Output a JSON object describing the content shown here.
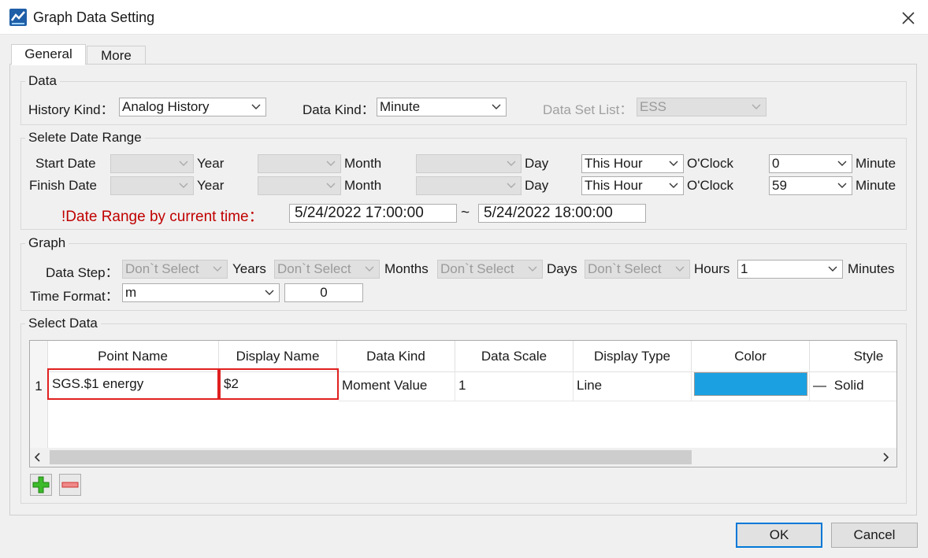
{
  "window": {
    "title": "Graph Data Setting",
    "close_glyph": "✕"
  },
  "tabs": [
    {
      "label": "General",
      "active": true
    },
    {
      "label": "More",
      "active": false
    }
  ],
  "data_group": {
    "legend": "Data",
    "history_kind": {
      "label": "History Kind：",
      "value": "Analog History"
    },
    "data_kind": {
      "label": "Data Kind：",
      "value": "Minute"
    },
    "data_set_list": {
      "label": "Data Set List：",
      "value": "ESS",
      "disabled": true
    }
  },
  "date_range": {
    "legend": "Selete Date Range",
    "start": {
      "label": "Start Date",
      "year_unit": "Year",
      "month_unit": "Month",
      "day_unit": "Day",
      "hour": "This Hour",
      "hour_unit": "O'Clock",
      "minute": "0",
      "minute_unit": "Minute"
    },
    "finish": {
      "label": "Finish Date",
      "year_unit": "Year",
      "month_unit": "Month",
      "day_unit": "Day",
      "hour": "This Hour",
      "hour_unit": "O'Clock",
      "minute": "59",
      "minute_unit": "Minute"
    },
    "current_label": "!Date Range by current time：",
    "range_from": "5/24/2022 17:00:00",
    "range_sep": "~",
    "range_to": "5/24/2022 18:00:00"
  },
  "graph": {
    "legend": "Graph",
    "data_step_label": "Data Step：",
    "years": {
      "value": "Don`t Select",
      "unit": "Years"
    },
    "months": {
      "value": "Don`t Select",
      "unit": "Months"
    },
    "days": {
      "value": "Don`t Select",
      "unit": "Days"
    },
    "hours": {
      "value": "Don`t Select",
      "unit": "Hours"
    },
    "minutes": {
      "value": "1",
      "unit": "Minutes"
    },
    "time_format_label": "Time Format：",
    "time_format_value": "m",
    "time_format_number": "0"
  },
  "select_data": {
    "legend": "Select Data",
    "columns": [
      "Point Name",
      "Display Name",
      "Data Kind",
      "Data Scale",
      "Display Type",
      "Color",
      "Style"
    ],
    "rows": [
      {
        "index": "1",
        "point_name": "SGS.$1 energy",
        "display_name": "$2",
        "data_kind": "Moment Value",
        "data_scale": "1",
        "display_type": "Line",
        "color": "#1ba1e2",
        "style_dash": "—",
        "style": "Solid"
      }
    ],
    "add_icon": "plus-icon",
    "remove_icon": "minus-icon"
  },
  "footer": {
    "ok": "OK",
    "cancel": "Cancel"
  },
  "colors": {
    "accent": "#0078d7",
    "warning_text": "#c00000",
    "highlight_border": "#e02020"
  }
}
